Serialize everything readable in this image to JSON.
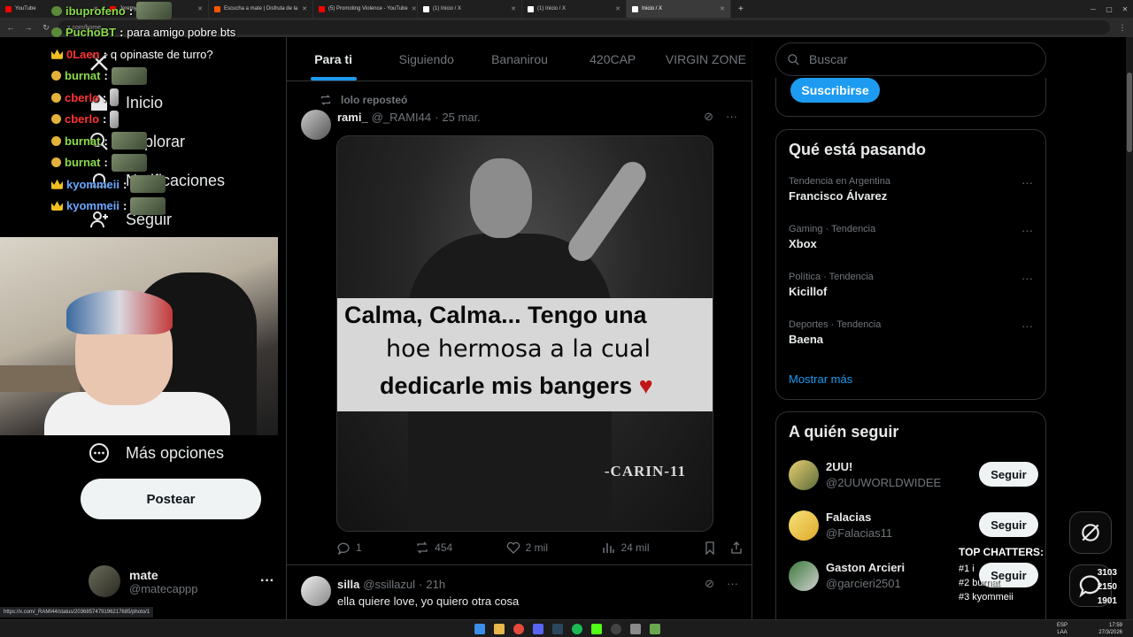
{
  "browser": {
    "tabs": [
      {
        "title": "YouTube",
        "color": "#ff0000",
        "active": false
      },
      {
        "title": "Jeremy - MATARON",
        "color": "#ff0000",
        "active": false
      },
      {
        "title": "Escucha a mate | Disfruta de la",
        "color": "#ff5500",
        "active": false
      },
      {
        "title": "(5) Promoting Violence - YouTube",
        "color": "#ff0000",
        "active": false
      },
      {
        "title": "(1) Inicio / X",
        "color": "#ffffff",
        "active": false
      },
      {
        "title": "(1) Inicio / X",
        "color": "#ffffff",
        "active": false
      },
      {
        "title": "Inicio / X",
        "color": "#ffffff",
        "active": true
      }
    ],
    "new_tab": "+",
    "url": "x.com/home",
    "status_url": "https://x.com/_RAMI44/status/2036857479196217685/photo/1"
  },
  "chat": [
    {
      "user": "ibuprofeno",
      "color": "#8bdc4a",
      "badge": "emote",
      "text": "",
      "emotes": 1
    },
    {
      "user": "PuchoBT",
      "color": "#8bdc4a",
      "badge": "emote",
      "text": "para amigo pobre bts",
      "emotes": 0
    },
    {
      "user": "0Laen",
      "color": "#ff3333",
      "badge": "crown",
      "text": "q opinaste de turro?",
      "emotes": 0
    },
    {
      "user": "burnat",
      "color": "#8bdc4a",
      "badge": "smile",
      "text": "",
      "emotes": 1
    },
    {
      "user": "cberlo",
      "color": "#ff3333",
      "badge": "smile",
      "text": "",
      "emotes": 0
    },
    {
      "user": "cberlo",
      "color": "#ff3333",
      "badge": "smile",
      "text": "",
      "emotes": 0
    },
    {
      "user": "burnat",
      "color": "#8bdc4a",
      "badge": "smile",
      "text": "",
      "emotes": 1
    },
    {
      "user": "burnat",
      "color": "#8bdc4a",
      "badge": "smile",
      "text": "",
      "emotes": 1
    },
    {
      "user": "kyommeii",
      "color": "#6aa8ff",
      "badge": "crown",
      "text": "",
      "emotes": 1
    },
    {
      "user": "kyommeii",
      "color": "#6aa8ff",
      "badge": "crown",
      "text": "",
      "emotes": 1
    }
  ],
  "nav": {
    "inicio": "Inicio",
    "explorar": "Explorar",
    "notificaciones": "Notificaciones",
    "seguir": "Seguir",
    "mas_opciones": "Más opciones",
    "postear": "Postear",
    "account_name": "mate",
    "account_handle": "@matecappp"
  },
  "timeline": {
    "tabs": [
      "Para ti",
      "Siguiendo",
      "Bananirou",
      "420CAP",
      "VIRGIN ZONE"
    ],
    "active_tab": 0,
    "tweet1": {
      "reposted_by": "lolo reposteó",
      "name": "rami_",
      "handle": "@_RAMI44",
      "date": "25 mar.",
      "meme_line1": "Calma, Calma... Tengo una",
      "meme_line2": "hoe hermosa a la cual",
      "meme_line3": "dedicarle mis bangers",
      "meme_heart": "♥",
      "watermark": "-CARIN-11",
      "replies": "1",
      "reposts": "454",
      "likes": "2 mil",
      "views": "24 mil"
    },
    "tweet2": {
      "name": "silla",
      "handle": "@ssillazul",
      "date": "21h",
      "text": "ella quiere love, yo quiero otra cosa"
    }
  },
  "sidebar": {
    "search_placeholder": "Buscar",
    "subscribe": "Suscribirse",
    "trends_title": "Qué está pasando",
    "trends": [
      {
        "category": "Tendencia en Argentina",
        "name": "Francisco Álvarez"
      },
      {
        "category": "Gaming · Tendencia",
        "name": "Xbox"
      },
      {
        "category": "Política · Tendencia",
        "name": "Kicillof"
      },
      {
        "category": "Deportes · Tendencia",
        "name": "Baena"
      }
    ],
    "show_more": "Mostrar más",
    "follow_title": "A quién seguir",
    "follow": [
      {
        "name": "2UU!",
        "handle": "@2UUWORLDWIDEE",
        "button": "Seguir"
      },
      {
        "name": "Falacias",
        "handle": "@Falacias11",
        "button": "Seguir"
      },
      {
        "name": "Gaston Arcieri",
        "handle": "@garcieri2501",
        "button": "Seguir"
      }
    ]
  },
  "overlay": {
    "top_chatters_title": "TOP CHATTERS:",
    "top_chatters": [
      "#1 i",
      "#2 burnat",
      "#3 kyommeii"
    ],
    "counts": [
      "3103",
      "2150",
      "1901"
    ]
  },
  "taskbar": {
    "lang": "ESP",
    "lang2": "LAA",
    "time": "17:59",
    "date": "27/3/2026"
  }
}
